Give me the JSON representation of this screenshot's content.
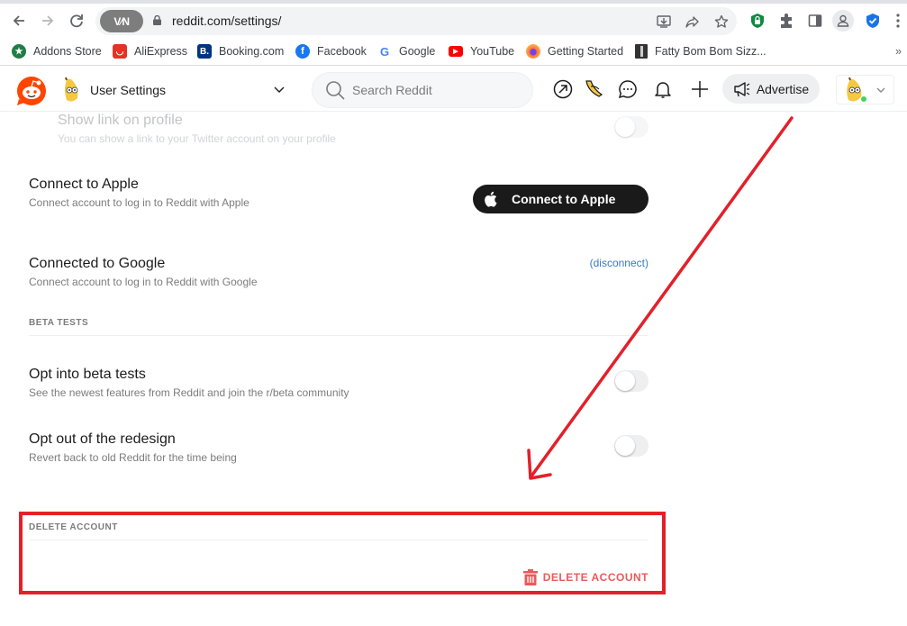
{
  "browser": {
    "url": "reddit.com/settings/",
    "vpn_label": "V⁄N",
    "nav": {
      "back_icon": "arrow-left-icon",
      "forward_icon": "arrow-right-icon",
      "reload_icon": "reload-icon"
    },
    "omnibox_icons": [
      "install-icon",
      "share-icon",
      "star-icon"
    ],
    "extension_icons": [
      "shield-lock-icon",
      "puzzle-icon",
      "side-panel-icon",
      "profile-icon",
      "shield-check-icon",
      "kebab-menu-icon"
    ],
    "bookmarks": [
      {
        "label": "Addons Store",
        "icon": "addons-store-icon",
        "color": "#1e7e45"
      },
      {
        "label": "AliExpress",
        "icon": "aliexpress-icon",
        "color": "#e43225"
      },
      {
        "label": "Booking.com",
        "icon": "booking-icon",
        "color": "#003580"
      },
      {
        "label": "Facebook",
        "icon": "facebook-icon",
        "color": "#1877f2"
      },
      {
        "label": "Google",
        "icon": "google-icon",
        "color": "#4285f4"
      },
      {
        "label": "YouTube",
        "icon": "youtube-icon",
        "color": "#ff0000"
      },
      {
        "label": "Getting Started",
        "icon": "firefox-icon",
        "color": "#ff7139"
      },
      {
        "label": "Fatty Bom Bom Sizz...",
        "icon": "bookmark-image-icon",
        "color": "#333333"
      }
    ],
    "more_bookmarks": "»"
  },
  "reddit_header": {
    "community_label": "User Settings",
    "search_placeholder": "Search Reddit",
    "advertise_label": "Advertise",
    "brand_color": "#ff4500"
  },
  "settings": {
    "show_link": {
      "title": "Show link on profile",
      "description": "You can show a link to your Twitter account on your profile",
      "enabled": false
    },
    "apple": {
      "title": "Connect to Apple",
      "description": "Connect account to log in to Reddit with Apple",
      "button_label": "Connect to Apple"
    },
    "google": {
      "title": "Connected to Google",
      "description": "Connect account to log in to Reddit with Google",
      "link_label": "(disconnect)"
    },
    "beta_section": {
      "heading": "BETA TESTS",
      "items": [
        {
          "title": "Opt into beta tests",
          "description": "See the newest features from Reddit and join the r/beta community",
          "enabled": false
        },
        {
          "title": "Opt out of the redesign",
          "description": "Revert back to old Reddit for the time being",
          "enabled": false
        }
      ]
    },
    "delete_section": {
      "heading": "DELETE ACCOUNT",
      "button_label": "DELETE ACCOUNT",
      "color": "#ea5a5a"
    }
  },
  "annotation": {
    "color": "#e3202a"
  }
}
